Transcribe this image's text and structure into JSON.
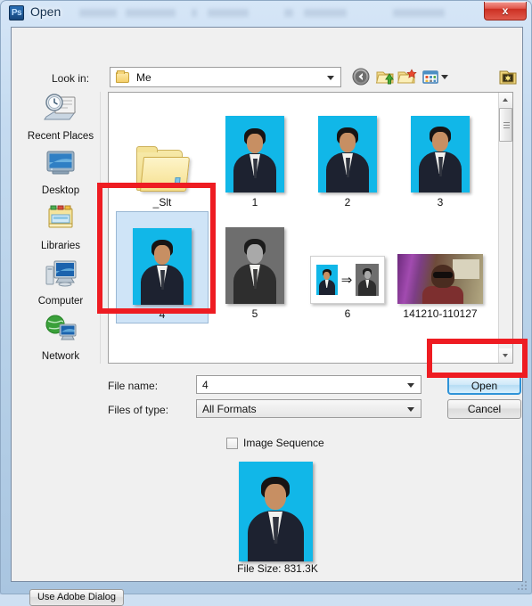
{
  "window": {
    "title": "Open",
    "app_icon": "photoshop-ps-icon",
    "app_icon_text": "Ps",
    "close_label": "x",
    "accent_red": "#ee1c22",
    "focus_blue": "#2f93d8"
  },
  "toolbar": {
    "lookin_label": "Look in:",
    "lookin_value": "Me",
    "icons": [
      {
        "name": "back-icon",
        "title": "Back"
      },
      {
        "name": "up-folder-icon",
        "title": "Up One Level"
      },
      {
        "name": "new-folder-icon",
        "title": "Create New Folder"
      },
      {
        "name": "views-icon",
        "title": "Views"
      },
      {
        "name": "tools-folder-icon",
        "title": "Tools"
      }
    ]
  },
  "sidebar": {
    "items": [
      {
        "label": "Recent Places",
        "icon": "recent-places-icon"
      },
      {
        "label": "Desktop",
        "icon": "desktop-icon"
      },
      {
        "label": "Libraries",
        "icon": "libraries-icon"
      },
      {
        "label": "Computer",
        "icon": "computer-icon"
      },
      {
        "label": "Network",
        "icon": "network-icon"
      }
    ]
  },
  "filelist": {
    "items": [
      {
        "label": "_Slt",
        "type": "folder",
        "selected": false
      },
      {
        "label": "1",
        "type": "photo-blue",
        "selected": false
      },
      {
        "label": "2",
        "type": "photo-blue",
        "selected": false
      },
      {
        "label": "3",
        "type": "photo-blue",
        "selected": false
      },
      {
        "label": "4",
        "type": "photo-blue",
        "selected": true
      },
      {
        "label": "5",
        "type": "photo-gray",
        "selected": false
      },
      {
        "label": "6",
        "type": "composite",
        "selected": false
      },
      {
        "label": "141210-110127",
        "type": "webcam-photo",
        "selected": false
      }
    ],
    "composite_arrow": "⇒"
  },
  "form": {
    "filename_label": "File name:",
    "filename_value": "4",
    "filetype_label": "Files of type:",
    "filetype_value": "All Formats",
    "open_label": "Open",
    "cancel_label": "Cancel"
  },
  "preview": {
    "sequence_label": "Image Sequence",
    "sequence_checked": false,
    "filesize_label": "File Size: 831.3K"
  },
  "footer": {
    "adobe_dialog_label": "Use Adobe Dialog"
  }
}
